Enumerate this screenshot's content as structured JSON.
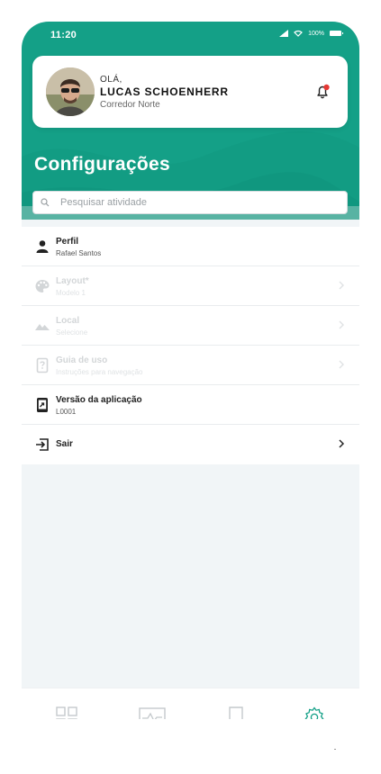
{
  "status": {
    "time": "11:20",
    "battery": "100%"
  },
  "profile": {
    "greeting": "OLÁ,",
    "name": "LUCAS SCHOENHERR",
    "subtitle": "Corredor Norte"
  },
  "page": {
    "title": "Configurações"
  },
  "search": {
    "placeholder": "Pesquisar atividade",
    "value": ""
  },
  "settings": {
    "items": [
      {
        "label": "Perfil",
        "description": "Rafael Santos",
        "icon": "person-icon",
        "enabled": true
      },
      {
        "label": "Layout*",
        "description": "Modelo 1",
        "icon": "palette-icon",
        "enabled": false
      },
      {
        "label": "Local",
        "description": "Selecione",
        "icon": "landscape-icon",
        "enabled": false
      },
      {
        "label": "Guia de uso",
        "description": "Instruções para navegação",
        "icon": "help-device-icon",
        "enabled": false
      },
      {
        "label": "Versão da aplicação",
        "description": "L0001",
        "icon": "phone-update-icon",
        "enabled": true
      },
      {
        "label": "Sair",
        "description": "",
        "icon": "logout-icon",
        "enabled": true
      }
    ]
  },
  "tabbar": {
    "tabs": [
      "grid-icon",
      "activity-icon",
      "bookmark-icon",
      "gear-icon"
    ],
    "active": "gear-icon"
  },
  "colors": {
    "primary": "#14a087",
    "notification": "#e53935"
  }
}
